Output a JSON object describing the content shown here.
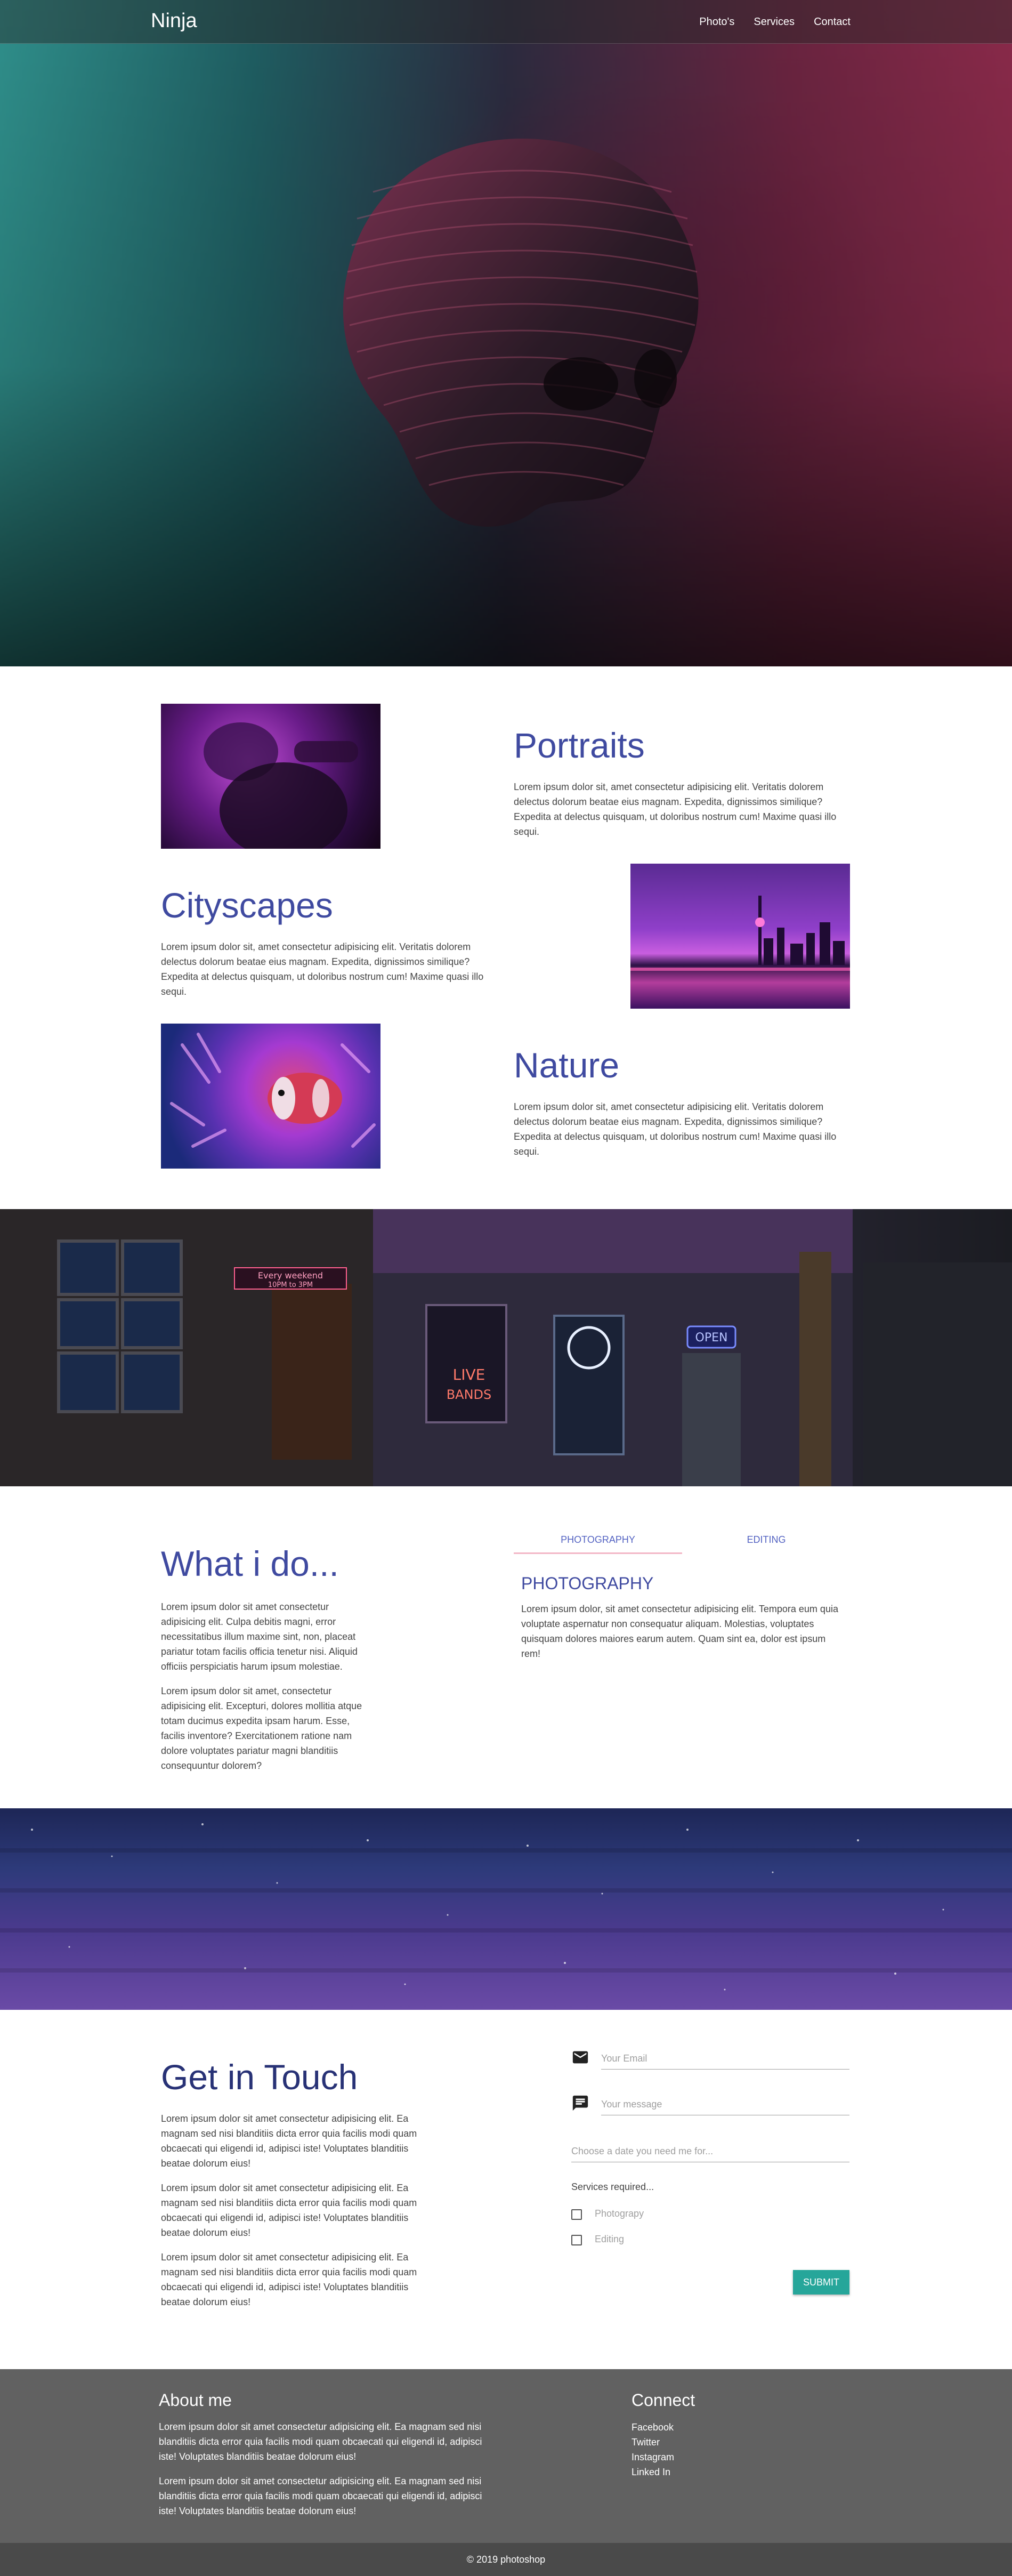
{
  "nav": {
    "brand": "Ninja",
    "links": [
      "Photo's",
      "Services",
      "Contact"
    ]
  },
  "gallery": [
    {
      "title": "Portraits",
      "text": "Lorem ipsum dolor sit, amet consectetur adipisicing elit. Veritatis dolorem delectus dolorum beatae eius magnam. Expedita, dignissimos similique? Expedita at delectus quisquam, ut doloribus nostrum cum! Maxime quasi illo sequi."
    },
    {
      "title": "Cityscapes",
      "text": "Lorem ipsum dolor sit, amet consectetur adipisicing elit. Veritatis dolorem delectus dolorum beatae eius magnam. Expedita, dignissimos similique? Expedita at delectus quisquam, ut doloribus nostrum cum! Maxime quasi illo sequi."
    },
    {
      "title": "Nature",
      "text": "Lorem ipsum dolor sit, amet consectetur adipisicing elit. Veritatis dolorem delectus dolorum beatae eius magnam. Expedita, dignissimos similique? Expedita at delectus quisquam, ut doloribus nostrum cum! Maxime quasi illo sequi."
    }
  ],
  "banner_signs": {
    "weekend": "Every weekend",
    "weekend_time": "10PM to 3PM",
    "live": "LIVE",
    "bands": "BANDS",
    "open": "OPEN"
  },
  "services": {
    "title": "What i do...",
    "paragraphs": [
      "Lorem ipsum dolor sit amet consectetur adipisicing elit. Culpa debitis magni, error necessitatibus illum maxime sint, non, placeat pariatur totam facilis officia tenetur nisi. Aliquid officiis perspiciatis harum ipsum molestiae.",
      "Lorem ipsum dolor sit amet, consectetur adipisicing elit. Excepturi, dolores mollitia atque totam ducimus expedita ipsam harum. Esse, facilis inventore? Exercitationem ratione nam dolore voluptates pariatur magni blanditiis consequuntur dolorem?"
    ],
    "tabs": [
      "PHOTOGRAPHY",
      "EDITING"
    ],
    "active_tab": "PHOTOGRAPHY",
    "tab_title": "PHOTOGRAPHY",
    "tab_text": "Lorem ipsum dolor, sit amet consectetur adipisicing elit. Tempora eum quia voluptate aspernatur non consequatur aliquam. Molestias, voluptates quisquam dolores maiores earum autem. Quam sint ea, dolor est ipsum rem!"
  },
  "contact": {
    "title": "Get in Touch",
    "paragraphs": [
      "Lorem ipsum dolor sit amet consectetur adipisicing elit. Ea magnam sed nisi blanditiis dicta error quia facilis modi quam obcaecati qui eligendi id, adipisci iste! Voluptates blanditiis beatae dolorum eius!",
      "Lorem ipsum dolor sit amet consectetur adipisicing elit. Ea magnam sed nisi blanditiis dicta error quia facilis modi quam obcaecati qui eligendi id, adipisci iste! Voluptates blanditiis beatae dolorum eius!",
      "Lorem ipsum dolor sit amet consectetur adipisicing elit. Ea magnam sed nisi blanditiis dicta error quia facilis modi quam obcaecati qui eligendi id, adipisci iste! Voluptates blanditiis beatae dolorum eius!"
    ],
    "email_placeholder": "Your Email",
    "message_placeholder": "Your message",
    "date_placeholder": "Choose a date you need me for...",
    "services_label": "Services required...",
    "options": [
      "Photograpy",
      "Editing"
    ],
    "submit_label": "Submit"
  },
  "footer": {
    "about_title": "About me",
    "about_paragraphs": [
      "Lorem ipsum dolor sit amet consectetur adipisicing elit. Ea magnam sed nisi blanditiis dicta error quia facilis modi quam obcaecati qui eligendi id, adipisci iste! Voluptates blanditiis beatae dolorum eius!",
      "Lorem ipsum dolor sit amet consectetur adipisicing elit. Ea magnam sed nisi blanditiis dicta error quia facilis modi quam obcaecati qui eligendi id, adipisci iste! Voluptates blanditiis beatae dolorum eius!"
    ],
    "connect_title": "Connect",
    "links": [
      "Facebook",
      "Twitter",
      "Instagram",
      "Linked In"
    ],
    "copyright": "© 2019 photoshop"
  },
  "colors": {
    "accent": "#3f4aa0",
    "tab_text": "#5463c2",
    "submit": "#26a69a",
    "footer": "#616161"
  },
  "icons": {
    "email_field": "email-icon",
    "message_field": "message-icon"
  }
}
